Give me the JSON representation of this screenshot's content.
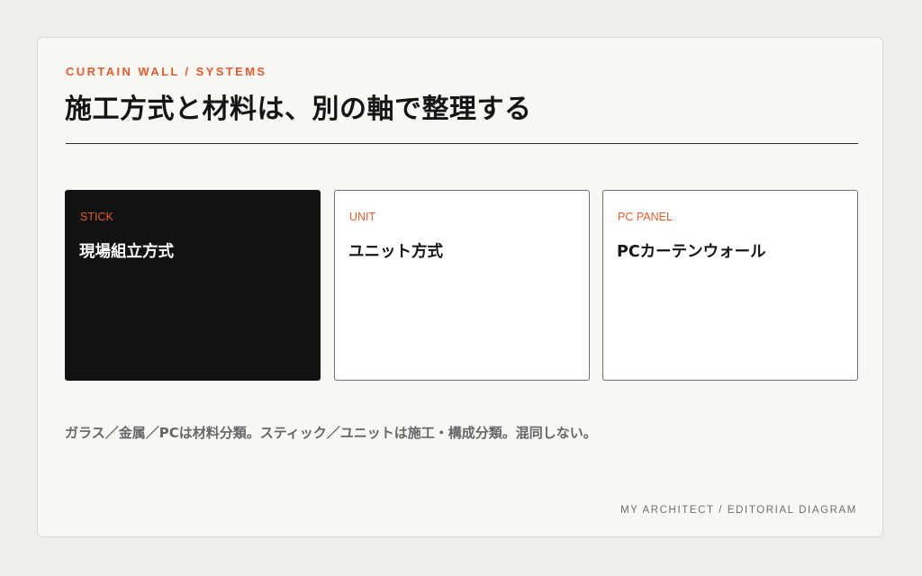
{
  "header": {
    "eyebrow": "CURTAIN WALL / SYSTEMS",
    "title": "施工方式と材料は、別の軸で整理する"
  },
  "colors": {
    "accent": "#e85a2a",
    "dark_box": "#111313",
    "background": "#efeeea",
    "card": "#f9f8f5"
  },
  "boxes": [
    {
      "label": "STICK",
      "text": "現場組立方式",
      "highlighted": true
    },
    {
      "label": "UNIT",
      "text": "ユニット方式",
      "highlighted": false
    },
    {
      "label": "PC PANEL",
      "text": "PCカーテンウォール",
      "highlighted": false
    }
  ],
  "note": "ガラス／金属／PCは材料分類。スティック／ユニットは施工・構成分類。混同しない。",
  "footer": "MY ARCHITECT / EDITORIAL DIAGRAM"
}
